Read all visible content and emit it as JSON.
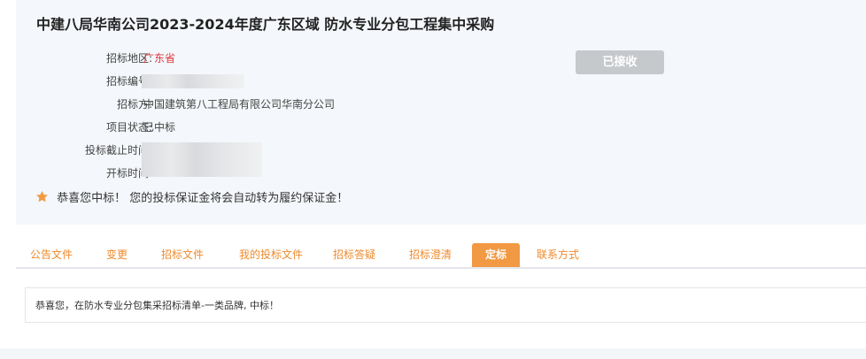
{
  "title": "中建八局华南公司2023-2024年度广东区域 防水专业分包工程集中采购",
  "fields": [
    {
      "label": "招标地区:",
      "value": "广东省",
      "value_color": "#e0383e"
    },
    {
      "label": "招标编号:",
      "value": null
    },
    {
      "label": "招标方:",
      "value": "中国建筑第八工程局有限公司华南分公司"
    },
    {
      "label": "项目状态:",
      "value": "已中标"
    },
    {
      "label": "投标截止时间:",
      "value": null
    },
    {
      "label": "开标时间:",
      "value": null
    }
  ],
  "status_button": "已接收",
  "congrats_message": "恭喜您中标！ 您的投标保证金将会自动转为履约保证金！",
  "tabs": [
    {
      "label": "公告文件",
      "active": false
    },
    {
      "label": "变更",
      "active": false
    },
    {
      "label": "招标文件",
      "active": false
    },
    {
      "label": "我的投标文件",
      "active": false
    },
    {
      "label": "招标答疑",
      "active": false
    },
    {
      "label": "招标澄清",
      "active": false
    },
    {
      "label": "定标",
      "active": true
    },
    {
      "label": "联系方式",
      "active": false
    }
  ],
  "content_message": "恭喜您，在防水专业分包集采招标清单-一类品牌, 中标！",
  "colors": {
    "accent": "#f19a43",
    "tab_text": "#ef8a2c",
    "region_value": "#e0383e",
    "panel_bg": "#f4f7fb",
    "status_button_bg": "#c6c9cc"
  },
  "icons": {
    "congrats": "star-icon"
  }
}
